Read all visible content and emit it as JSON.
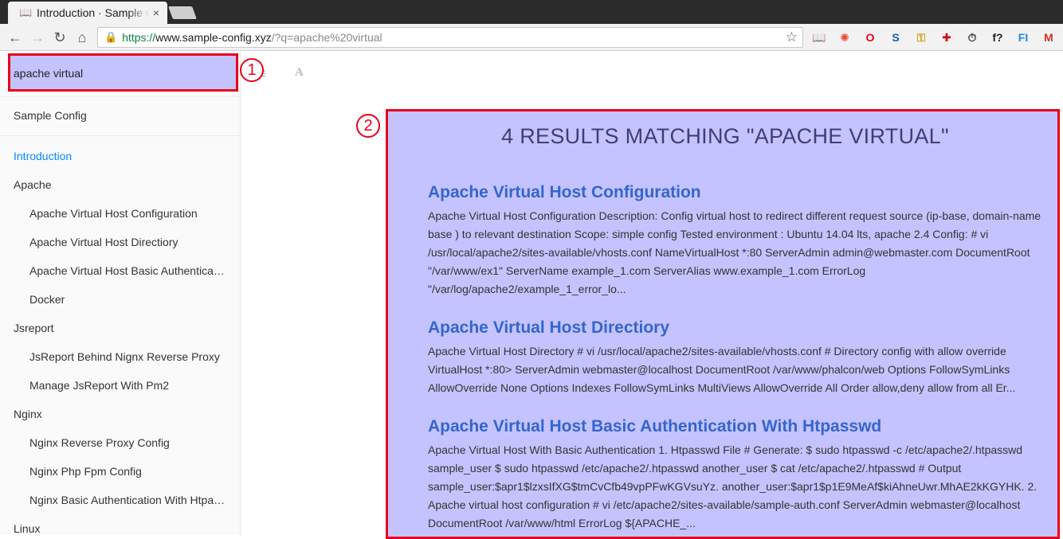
{
  "browser": {
    "tab_title": "Introduction · Sample Config",
    "tab_close": "×",
    "url_scheme": "https://",
    "url_host": "www.sample-config.xyz",
    "url_rest": "/?q=apache%20virtual"
  },
  "extensions": [
    {
      "name": "book-icon",
      "glyph": "📖",
      "color": "#333333"
    },
    {
      "name": "color-wheel-icon",
      "glyph": "✺",
      "color": "#e94b35"
    },
    {
      "name": "opera-icon",
      "glyph": "O",
      "color": "#e8001c"
    },
    {
      "name": "s-logo-icon",
      "glyph": "S",
      "color": "#1a5aa6"
    },
    {
      "name": "key-icon",
      "glyph": "⚿",
      "color": "#d4a017"
    },
    {
      "name": "cross-icon",
      "glyph": "✚",
      "color": "#d0021b"
    },
    {
      "name": "timer-icon",
      "glyph": "⏱",
      "color": "#444444"
    },
    {
      "name": "font-question-icon",
      "glyph": "f?",
      "color": "#222222"
    },
    {
      "name": "fi-icon",
      "glyph": "FI",
      "color": "#1e88e5"
    },
    {
      "name": "gmail-icon",
      "glyph": "M",
      "color": "#d93025"
    }
  ],
  "sidebar": {
    "search_value": "apache virtual",
    "site_title": "Sample Config",
    "items": [
      {
        "label": "Introduction",
        "level": 0,
        "active": true
      },
      {
        "label": "Apache",
        "level": 0
      },
      {
        "label": "Apache Virtual Host Configuration",
        "level": 1
      },
      {
        "label": "Apache Virtual Host Directiory",
        "level": 1
      },
      {
        "label": "Apache Virtual Host Basic Authentication With Htpasswd",
        "level": 1
      },
      {
        "label": "Docker",
        "level": 1
      },
      {
        "label": "Jsreport",
        "level": 0
      },
      {
        "label": "JsReport Behind Nignx Reverse Proxy",
        "level": 1
      },
      {
        "label": "Manage JsReport With Pm2",
        "level": 1
      },
      {
        "label": "Nginx",
        "level": 0
      },
      {
        "label": "Nginx Reverse Proxy Config",
        "level": 1
      },
      {
        "label": "Nginx Php Fpm Config",
        "level": 1
      },
      {
        "label": "Nginx Basic Authentication With Htpasswd",
        "level": 1
      },
      {
        "label": "Linux",
        "level": 0
      }
    ]
  },
  "annotations": {
    "badge_1": "1",
    "badge_2": "2"
  },
  "content": {
    "font_icon": "A",
    "results_title": "4 RESULTS MATCHING \"APACHE VIRTUAL\"",
    "results": [
      {
        "title": "Apache Virtual Host Configuration",
        "body": "Apache Virtual Host Configuration Description: Config virtual host to redirect different request source (ip-base, domain-name base ) to relevant destination Scope: simple config Tested environment : Ubuntu 14.04 lts, apache 2.4 Config: # vi /usr/local/apache2/sites-available/vhosts.conf NameVirtualHost *:80 ServerAdmin admin@webmaster.com DocumentRoot \"/var/www/ex1\" ServerName example_1.com ServerAlias www.example_1.com ErrorLog \"/var/log/apache2/example_1_error_lo..."
      },
      {
        "title": "Apache Virtual Host Directiory",
        "body": "Apache Virtual Host Directory # vi /usr/local/apache2/sites-available/vhosts.conf # Directory config with allow override VirtualHost *:80> ServerAdmin webmaster@localhost DocumentRoot /var/www/phalcon/web Options FollowSymLinks AllowOverride None Options Indexes FollowSymLinks MultiViews AllowOverride All Order allow,deny allow from all Er..."
      },
      {
        "title": "Apache Virtual Host Basic Authentication With Htpasswd",
        "body": "Apache Virtual Host With Basic Authentication 1. Htpasswd File # Generate: $ sudo htpasswd -c /etc/apache2/.htpasswd sample_user $ sudo htpasswd /etc/apache2/.htpasswd another_user $ cat /etc/apache2/.htpasswd # Output sample_user:$apr1$lzxsIfXG$tmCvCfb49vpPFwKGVsuYz. another_user:$apr1$p1E9MeAf$kiAhneUwr.MhAE2kKGYHK. 2. Apache virtual host configuration # vi /etc/apache2/sites-available/sample-auth.conf ServerAdmin webmaster@localhost DocumentRoot /var/www/html ErrorLog ${APACHE_..."
      }
    ]
  }
}
